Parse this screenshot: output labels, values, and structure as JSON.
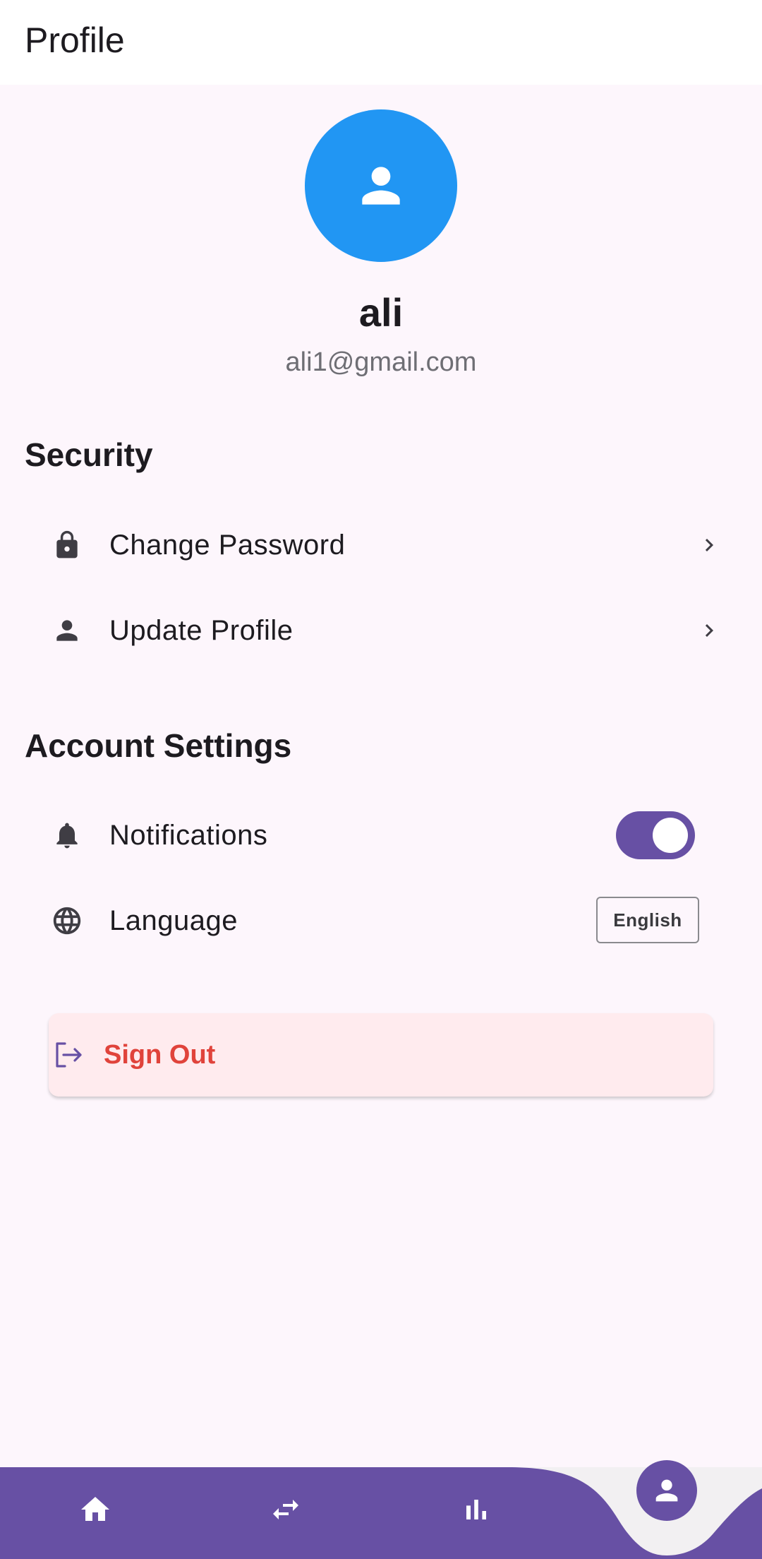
{
  "appbar": {
    "title": "Profile"
  },
  "profile": {
    "name": "ali",
    "email": "ali1@gmail.com",
    "avatar_icon": "person-icon",
    "avatar_color": "#2196F3"
  },
  "security": {
    "title": "Security",
    "items": [
      {
        "label": "Change Password",
        "icon": "lock-icon",
        "trailing": "chevron-right-icon"
      },
      {
        "label": "Update Profile",
        "icon": "person-icon",
        "trailing": "chevron-right-icon"
      }
    ]
  },
  "account_settings": {
    "title": "Account Settings",
    "notifications": {
      "label": "Notifications",
      "icon": "bell-icon",
      "enabled": true
    },
    "language": {
      "label": "Language",
      "icon": "globe-icon",
      "value": "English"
    }
  },
  "sign_out": {
    "label": "Sign Out",
    "icon": "logout-icon",
    "color": "#E0433B",
    "background": "#FFEBEE"
  },
  "bottom_nav": {
    "accent": "#6750A4",
    "items": [
      {
        "icon": "home-icon",
        "active": false
      },
      {
        "icon": "swap-icon",
        "active": false
      },
      {
        "icon": "bar-chart-icon",
        "active": false
      },
      {
        "icon": "person-icon",
        "active": true
      }
    ]
  }
}
